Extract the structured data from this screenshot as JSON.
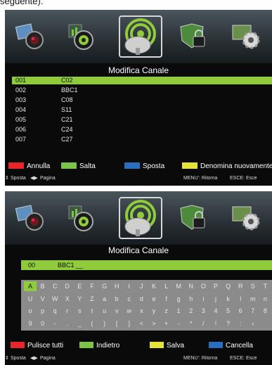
{
  "caption": "seguente).",
  "colors": {
    "red": "#e8252b",
    "green": "#7cc34a",
    "blue": "#2a6fbf",
    "yellow": "#e6e23c",
    "highlight": "#8fcb3a"
  },
  "menu_icons": [
    "picture-icon",
    "sound-icon",
    "channel-icon",
    "lock-icon",
    "settings-icon"
  ],
  "screen1": {
    "title": "Modifica Canale",
    "channels": [
      {
        "num": "001",
        "name": "C02"
      },
      {
        "num": "002",
        "name": "BBC1"
      },
      {
        "num": "003",
        "name": "C08"
      },
      {
        "num": "004",
        "name": "S11"
      },
      {
        "num": "005",
        "name": "C21"
      },
      {
        "num": "006",
        "name": "C24"
      },
      {
        "num": "007",
        "name": "C27"
      }
    ],
    "legend": {
      "red": "Annulla",
      "green": "Salta",
      "blue": "Sposta",
      "yellow": "Denomina nuovamente"
    },
    "status": {
      "move": "Sposta",
      "page": "Pagina",
      "menu": "MENU': Ritorna",
      "exit": "ESCE: Esce"
    }
  },
  "screen2": {
    "title": "Modifica Canale",
    "field": {
      "num": "00",
      "value": "BBC1 __"
    },
    "keyboard": {
      "active_key": "A",
      "rows": [
        [
          "A",
          "B",
          "C",
          "D",
          "E",
          "F",
          "G",
          "H",
          "I",
          "J",
          "K",
          "L",
          "M",
          "N",
          "O",
          "P",
          "Q",
          "R",
          "S",
          "T"
        ],
        [
          "U",
          "V",
          "W",
          "X",
          "Y",
          "Z",
          "a",
          "b",
          "c",
          "d",
          "e",
          "f",
          "g",
          "h",
          "i",
          "j",
          "k",
          "l",
          "m",
          "n"
        ],
        [
          "o",
          "p",
          "q",
          "r",
          "s",
          "t",
          "u",
          "v",
          "w",
          "x",
          "y",
          "z",
          "1",
          "2",
          "3",
          "4",
          "5",
          "6",
          "7",
          "8"
        ],
        [
          "9",
          "0",
          "-",
          ".",
          "_",
          "(",
          ")",
          "[",
          "]",
          "<",
          ">",
          "+",
          "-",
          "*",
          "/",
          "!",
          "?",
          ":",
          "‹",
          ""
        ]
      ]
    },
    "legend": {
      "red": "Pulisce tutti",
      "green": "Indietro",
      "yellow": "Salva",
      "blue": "Cancella"
    },
    "status": {
      "move": "Sposta",
      "page": "Pagina",
      "menu": "MENU': Ritorna",
      "exit": "ESCE: Esce"
    }
  }
}
